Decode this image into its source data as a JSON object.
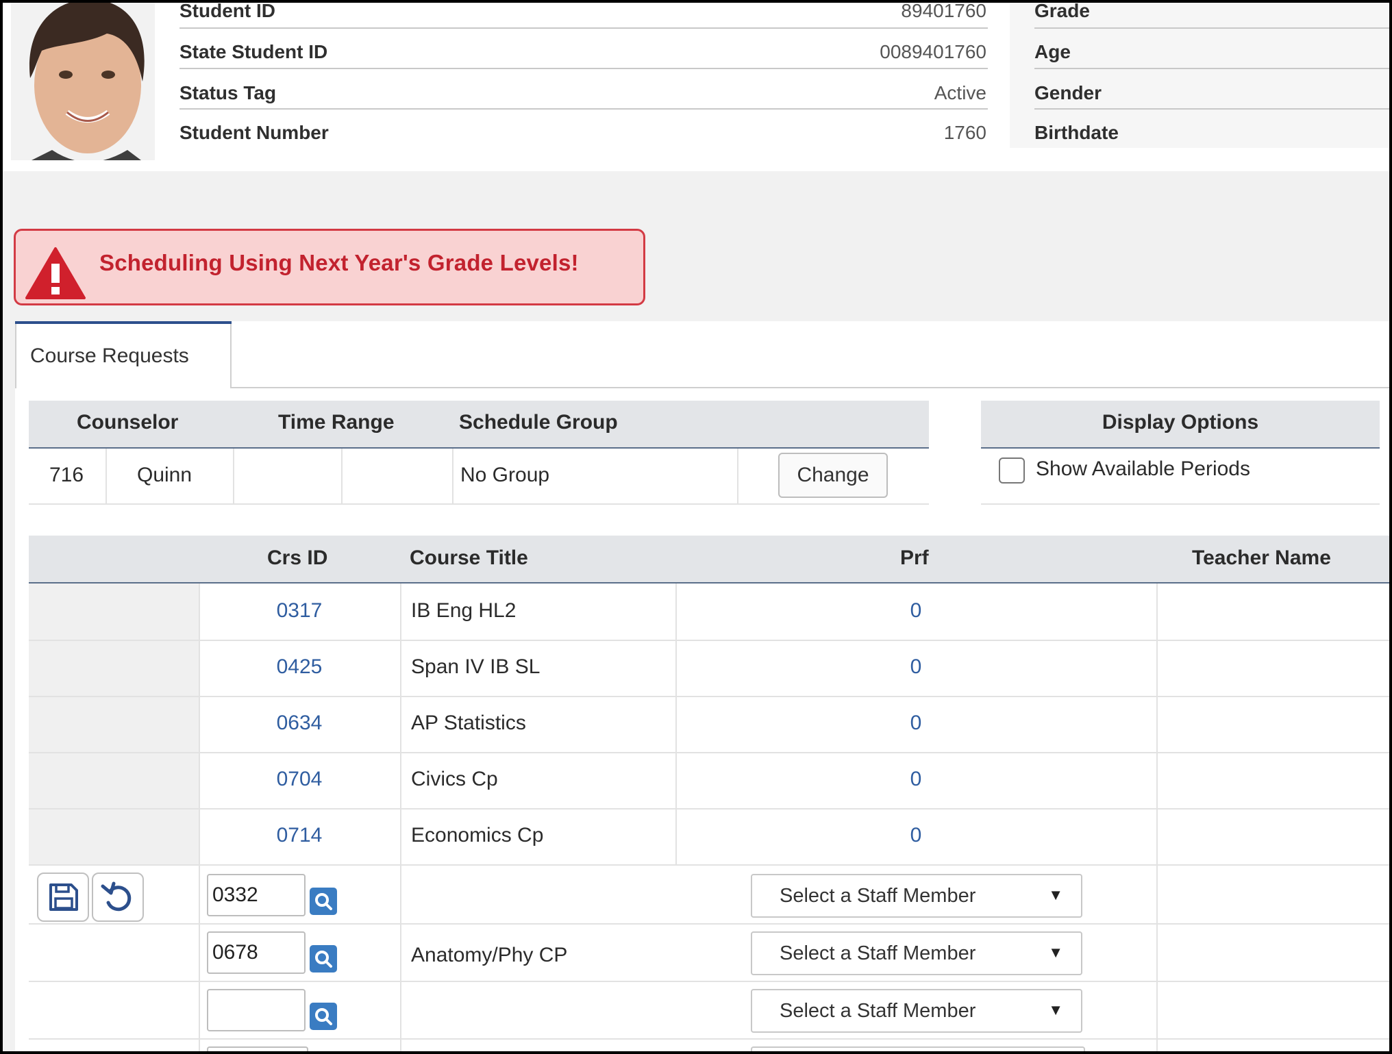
{
  "student": {
    "fields_left": [
      {
        "label": "Student ID",
        "value": "89401760"
      },
      {
        "label": "State Student ID",
        "value": "0089401760"
      },
      {
        "label": "Status Tag",
        "value": "Active"
      },
      {
        "label": "Student Number",
        "value": "1760"
      }
    ],
    "fields_right": [
      {
        "label": "Grade"
      },
      {
        "label": "Age"
      },
      {
        "label": "Gender"
      },
      {
        "label": "Birthdate"
      }
    ]
  },
  "banner": {
    "text": "Scheduling Using Next Year's Grade Levels!"
  },
  "tabs": [
    {
      "label": "Course Requests"
    }
  ],
  "counselor_table": {
    "headers": [
      "Counselor",
      "Time Range",
      "Schedule Group"
    ],
    "row": {
      "counselor_id": "716",
      "counselor_name": "Quinn",
      "group": "No Group",
      "change_label": "Change"
    }
  },
  "display_options": {
    "title": "Display Options",
    "checkbox_label": "Show Available Periods",
    "checked": false
  },
  "requests_table": {
    "headers": {
      "crs_id": "Crs ID",
      "title": "Course Title",
      "prf": "Prf",
      "teacher": "Teacher Name"
    },
    "rows": [
      {
        "crs_id": "0317",
        "title": "IB Eng HL2",
        "prf": "0"
      },
      {
        "crs_id": "0425",
        "title": "Span IV IB SL",
        "prf": "0"
      },
      {
        "crs_id": "0634",
        "title": "AP Statistics",
        "prf": "0"
      },
      {
        "crs_id": "0704",
        "title": "Civics Cp",
        "prf": "0"
      },
      {
        "crs_id": "0714",
        "title": "Economics Cp",
        "prf": "0"
      }
    ],
    "edit_rows": [
      {
        "crs_id": "0332",
        "title": "",
        "staff_select": "Select a Staff Member"
      },
      {
        "crs_id": "0678",
        "title": "Anatomy/Phy CP",
        "staff_select": "Select a Staff Member"
      },
      {
        "crs_id": "",
        "title": "",
        "staff_select": "Select a Staff Member"
      }
    ]
  },
  "icons": {
    "save": "save-icon",
    "undo": "undo-icon",
    "search": "search-icon",
    "warning": "warning-icon",
    "dropdown": "caret-down-icon"
  }
}
